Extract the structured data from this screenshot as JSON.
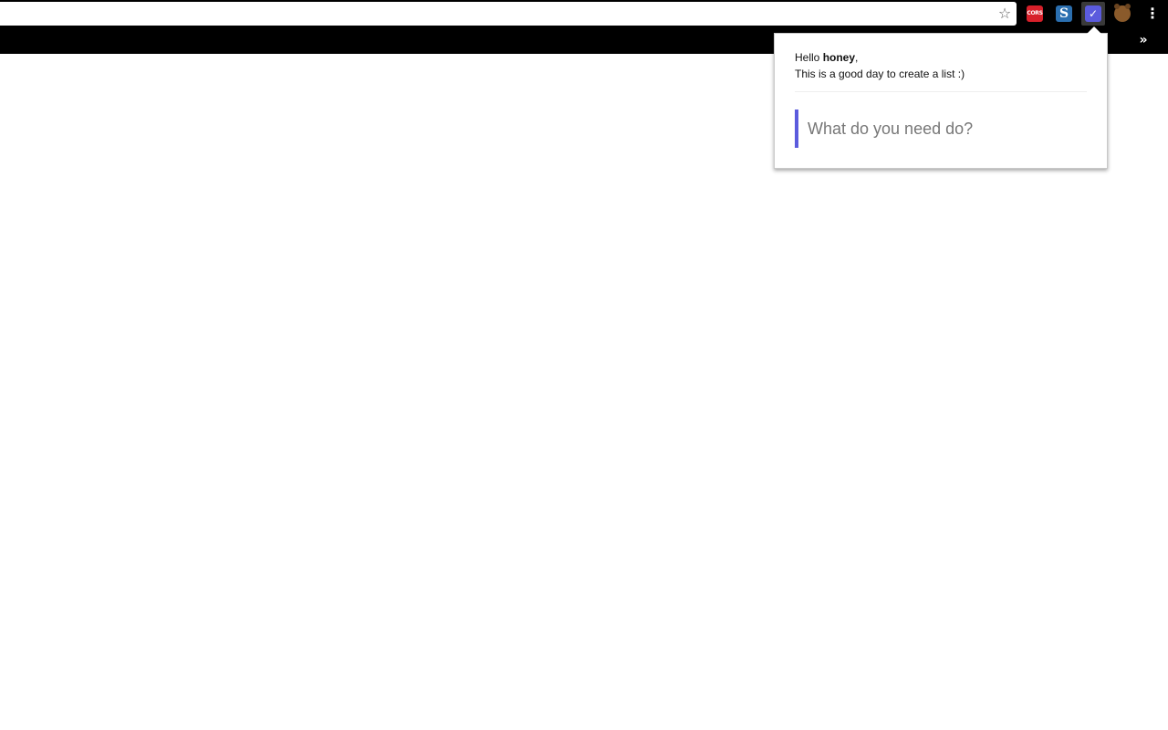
{
  "browser": {
    "omnibox": {
      "value": ""
    },
    "icons": {
      "bookmark_star": "star-icon",
      "extensions": [
        {
          "name": "cors-extension-icon",
          "label": "CORS",
          "color": "#d7202a"
        },
        {
          "name": "s-extension-icon",
          "label": "S",
          "color": "#2b6fb0"
        },
        {
          "name": "todo-extension-icon",
          "glyph": "✓",
          "color": "#5b5bdd"
        },
        {
          "name": "honey-extension-icon",
          "color": "#8a5a2b"
        }
      ],
      "menu": "kebab-menu-icon",
      "bookmarks_overflow": "chevron-double-right-icon"
    },
    "glyphs": {
      "star": "☆",
      "kebab": "⋮",
      "chevron": "»"
    }
  },
  "popup": {
    "greeting_prefix": "Hello ",
    "username": "honey",
    "greeting_suffix": ",",
    "subtitle": "This is a good day to create a list :)",
    "input": {
      "placeholder": "What do you need do?",
      "value": ""
    },
    "accent_color": "#5b5bdd"
  }
}
